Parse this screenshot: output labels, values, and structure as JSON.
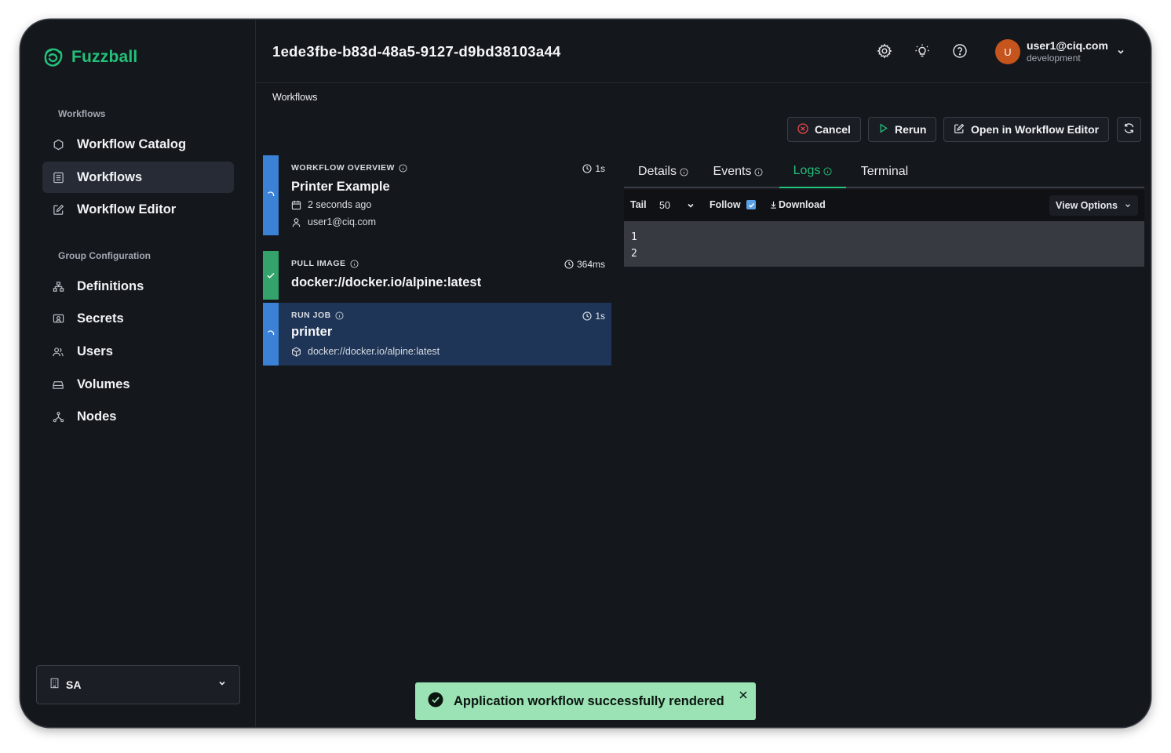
{
  "app": {
    "name": "Fuzzball",
    "brand_color": "#22c27a"
  },
  "sidebar": {
    "sections": [
      {
        "heading": "Workflows",
        "items": [
          {
            "label": "Workflow Catalog",
            "icon": "hexagon-icon"
          },
          {
            "label": "Workflows",
            "icon": "list-icon",
            "active": true
          },
          {
            "label": "Workflow Editor",
            "icon": "edit-icon"
          }
        ]
      },
      {
        "heading": "Group Configuration",
        "items": [
          {
            "label": "Definitions",
            "icon": "hierarchy-icon"
          },
          {
            "label": "Secrets",
            "icon": "secret-icon"
          },
          {
            "label": "Users",
            "icon": "users-icon"
          },
          {
            "label": "Volumes",
            "icon": "drive-icon"
          },
          {
            "label": "Nodes",
            "icon": "nodes-icon"
          }
        ]
      }
    ],
    "org_select": {
      "value": "SA",
      "icon": "building-icon"
    }
  },
  "header": {
    "workflow_id": "1ede3fbe-b83d-48a5-9127-d9bd38103a44",
    "icons": [
      "settings-icon",
      "theme-icon",
      "help-icon"
    ],
    "user": {
      "avatar_letter": "U",
      "email": "user1@ciq.com",
      "environment": "development",
      "avatar_color": "#c5541d"
    }
  },
  "breadcrumb": "Workflows",
  "actions": {
    "cancel": "Cancel",
    "rerun": "Rerun",
    "open_editor": "Open in Workflow Editor",
    "refresh_icon": "refresh-icon"
  },
  "steps": [
    {
      "type": "WORKFLOW OVERVIEW",
      "title": "Printer Example",
      "duration": "1s",
      "status": "running",
      "created": "2 seconds ago",
      "user": "user1@ciq.com"
    },
    {
      "type": "PULL IMAGE",
      "title": "docker://docker.io/alpine:latest",
      "duration": "364ms",
      "status": "success"
    },
    {
      "type": "RUN JOB",
      "title": "printer",
      "duration": "1s",
      "status": "running",
      "image": "docker://docker.io/alpine:latest"
    }
  ],
  "tabs": [
    {
      "label": "Details",
      "info": true
    },
    {
      "label": "Events",
      "info": true
    },
    {
      "label": "Logs",
      "info": true,
      "active": true
    },
    {
      "label": "Terminal",
      "info": false
    }
  ],
  "logs": {
    "tail_label": "Tail",
    "tail_value": "50",
    "follow_label": "Follow",
    "follow_checked": true,
    "download_label": "Download",
    "view_options_label": "View Options",
    "lines": [
      "1",
      "2"
    ]
  },
  "toast": {
    "message": "Application workflow successfully rendered",
    "color": "#9be3b4"
  },
  "colors": {
    "running": "#3b82d6",
    "success": "#33a36b",
    "selected_card": "#1e3558"
  }
}
